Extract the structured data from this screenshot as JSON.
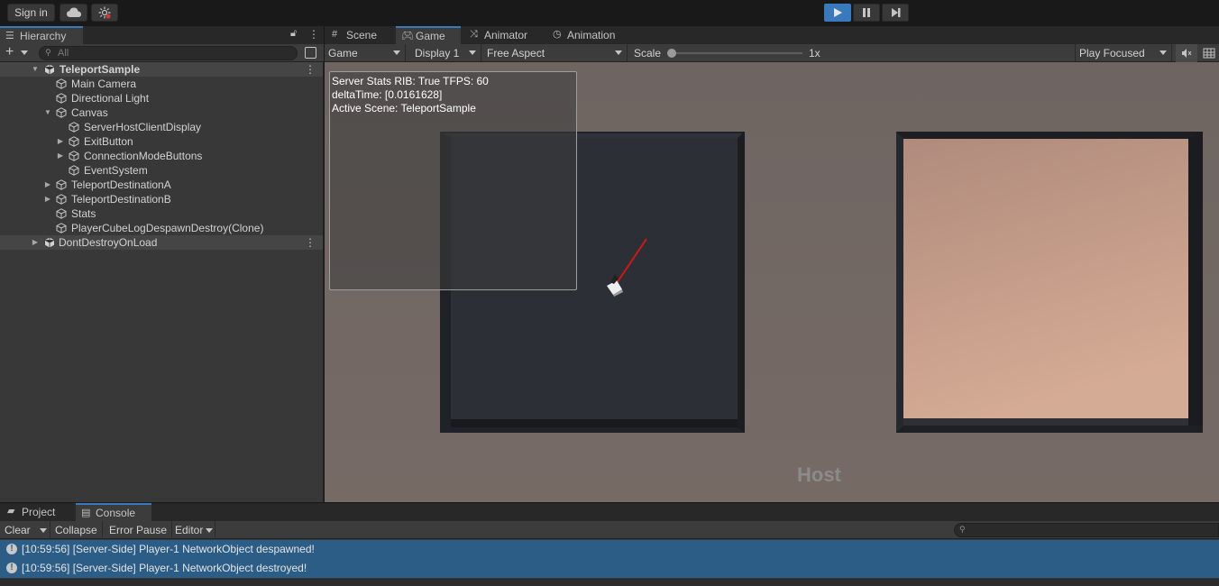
{
  "toolbar": {
    "sign_in": "Sign in",
    "cloud_icon": "cloud-icon",
    "collab_icon": "collab-icon",
    "play_icon": "play-icon",
    "pause_icon": "pause-icon",
    "step_icon": "step-icon"
  },
  "hierarchy": {
    "tab_label": "Hierarchy",
    "search_placeholder": "All",
    "items": [
      {
        "label": "TeleportSample"
      },
      {
        "label": "Main Camera"
      },
      {
        "label": "Directional Light"
      },
      {
        "label": "Canvas"
      },
      {
        "label": "ServerHostClientDisplay"
      },
      {
        "label": "ExitButton"
      },
      {
        "label": "ConnectionModeButtons"
      },
      {
        "label": "EventSystem"
      },
      {
        "label": "TeleportDestinationA"
      },
      {
        "label": "TeleportDestinationB"
      },
      {
        "label": "Stats"
      },
      {
        "label": "PlayerCubeLogDespawnDestroy(Clone)"
      },
      {
        "label": "DontDestroyOnLoad"
      }
    ]
  },
  "game": {
    "tabs": [
      {
        "label": "Scene"
      },
      {
        "label": "Game"
      },
      {
        "label": "Animator"
      },
      {
        "label": "Animation"
      }
    ],
    "view_mode": "Game",
    "display": "Display 1",
    "aspect": "Free Aspect",
    "scale_label": "Scale",
    "scale_value": "1x",
    "play_mode": "Play Focused",
    "stats_lines": [
      "Server Stats RIB: True TFPS: 60",
      "deltaTime: [0.0161628]",
      "Active Scene: TeleportSample"
    ],
    "host_label": "Host"
  },
  "console": {
    "tabs": [
      {
        "label": "Project"
      },
      {
        "label": "Console"
      }
    ],
    "clear": "Clear",
    "collapse": "Collapse",
    "error_pause": "Error Pause",
    "editor": "Editor",
    "logs": [
      {
        "text": "[10:59:56] [Server-Side] Player-1 NetworkObject despawned!"
      },
      {
        "text": "[10:59:56] [Server-Side] Player-1 NetworkObject destroyed!"
      }
    ]
  }
}
